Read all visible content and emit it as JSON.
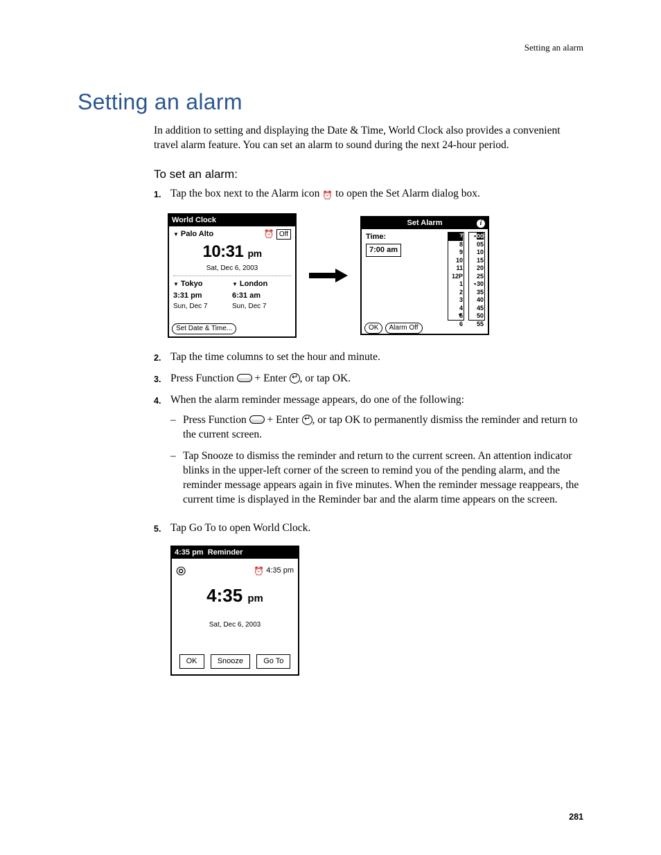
{
  "runningHead": "Setting an alarm",
  "title": "Setting an alarm",
  "intro": "In addition to setting and displaying the Date & Time, World Clock also provides a convenient travel alarm feature. You can set an alarm to sound during the next 24-hour period.",
  "subhead": "To set an alarm:",
  "steps": {
    "s1a": "Tap the box next to the Alarm icon ",
    "s1b": " to open the Set Alarm dialog box.",
    "s2": "Tap the time columns to set the hour and minute.",
    "s3a": "Press Function ",
    "s3b": " + Enter ",
    "s3c": ", or tap OK.",
    "s4": "When the alarm reminder message appears, do one of the following:",
    "s4_1a": "Press Function ",
    "s4_1b": " + Enter ",
    "s4_1c": ", or tap OK to permanently dismiss the reminder and return to the current screen.",
    "s4_2": "Tap Snooze to dismiss the reminder and return to the current screen. An attention indicator blinks in the upper-left corner of the screen to remind you of the pending alarm, and the reminder message appears again in five minutes. When the reminder message reappears, the current time is displayed in the Reminder bar and the alarm time appears on the screen.",
    "s5": "Tap Go To to open World Clock."
  },
  "worldClock": {
    "title": "World Clock",
    "alarmState": "Off",
    "primaryCity": "Palo Alto",
    "primaryTime": "10:31",
    "primaryAmPm": "pm",
    "primaryDate": "Sat, Dec 6, 2003",
    "city2": {
      "name": "Tokyo",
      "time": "3:31 pm",
      "date": "Sun, Dec 7"
    },
    "city3": {
      "name": "London",
      "time": "6:31 am",
      "date": "Sun, Dec 7"
    },
    "setBtn": "Set Date & Time..."
  },
  "setAlarm": {
    "title": "Set Alarm",
    "timeLabel": "Time:",
    "timeValue": "7:00 am",
    "hours": [
      "7",
      "8",
      "9",
      "10",
      "11",
      "12P",
      "1",
      "2",
      "3",
      "4",
      "5",
      "6"
    ],
    "minutes": [
      "00",
      "05",
      "10",
      "15",
      "20",
      "25",
      "30",
      "35",
      "40",
      "45",
      "50",
      "55"
    ],
    "hourSel": "7",
    "minSel": "00",
    "okBtn": "OK",
    "offBtn": "Alarm Off"
  },
  "reminder": {
    "barTime": "4:35 pm",
    "barLabel": "Reminder",
    "alarmTime": "4:35 pm",
    "bigTime": "4:35",
    "bigAmPm": "pm",
    "date": "Sat, Dec 6, 2003",
    "okBtn": "OK",
    "snoozeBtn": "Snooze",
    "gotoBtn": "Go To"
  },
  "pageNumber": "281"
}
